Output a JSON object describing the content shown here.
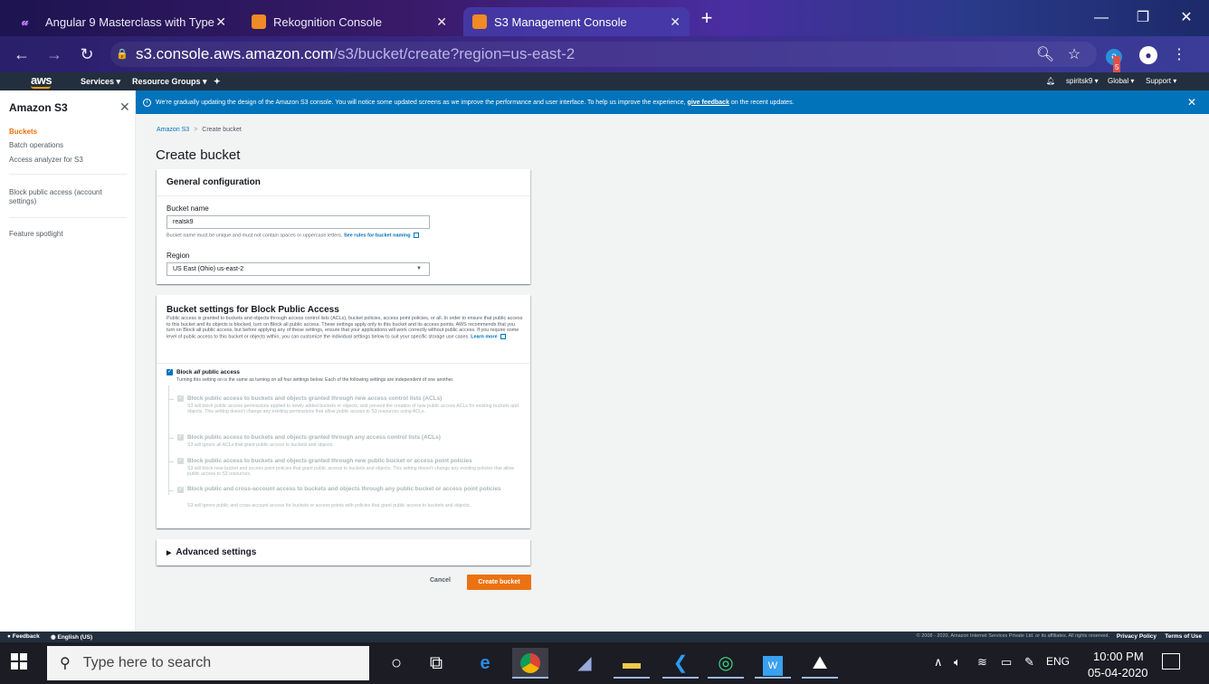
{
  "browser": {
    "tabs": [
      {
        "label": "Angular 9 Masterclass with Type",
        "icon": "udemy-icon",
        "color": "#a435f0",
        "active": false
      },
      {
        "label": "Rekognition Console",
        "icon": "aws-box-icon",
        "color": "#f90",
        "active": false
      },
      {
        "label": "S3 Management Console",
        "icon": "aws-box-icon",
        "color": "#f90",
        "active": true
      }
    ],
    "url_host": "s3.console.aws.amazon.com",
    "url_path": "/s3/bucket/create?region=us-east-2",
    "extension_badge": "5"
  },
  "aws_nav": {
    "logo": "aws",
    "services": "Services",
    "resource_groups": "Resource Groups",
    "user": "spiritsk9",
    "region": "Global",
    "support": "Support"
  },
  "sidebar": {
    "title": "Amazon S3",
    "items": [
      {
        "label": "Buckets",
        "active": true
      },
      {
        "label": "Batch operations"
      },
      {
        "label": "Access analyzer for S3"
      },
      {
        "label": "Block public access (account"
      },
      {
        "label": "settings)"
      },
      {
        "label": "Feature spotlight"
      }
    ]
  },
  "banner": {
    "text": "We're gradually updating the design of the Amazon S3 console. You will notice some updated screens as we improve the performance and user interface. To help us improve the experience,",
    "link": "give feedback",
    "tail": "on the recent updates."
  },
  "breadcrumb": {
    "root": "Amazon S3",
    "current": "Create bucket"
  },
  "page_title": "Create bucket",
  "general": {
    "header": "General configuration",
    "bucket_name_label": "Bucket name",
    "bucket_name_value": "realsk9",
    "bucket_name_hint": "Bucket name must be unique and must not contain spaces or uppercase letters.",
    "bucket_name_hint_link": "See rules for bucket naming",
    "region_label": "Region",
    "region_value": "US East (Ohio) us-east-2"
  },
  "bpa": {
    "title": "Bucket settings for Block Public Access",
    "description": "Public access is granted to buckets and objects through access control lists (ACLs), bucket policies, access point policies, or all. In order to ensure that public access to this bucket and its objects is blocked, turn on Block all public access. These settings apply only to this bucket and its access points. AWS recommends that you turn on Block all public access, but before applying any of these settings, ensure that your applications will work correctly without public access. If you require some level of public access to this bucket or objects within, you can customize the individual settings below to suit your specific storage use cases.",
    "learn_more": "Learn more",
    "block_all_title_pre": "Block ",
    "block_all_title_em": "all",
    "block_all_title_post": " public access",
    "block_all_desc": "Turning this setting on is the same as turning on all four settings below. Each of the following settings are independent of one another.",
    "options": [
      {
        "title": "Block public access to buckets and objects granted through new access control lists (ACLs)",
        "desc": "S3 will block public access permissions applied to newly added buckets or objects, and prevent the creation of new public access ACLs for existing buckets and objects. This setting doesn't change any existing permissions that allow public access to S3 resources using ACLs."
      },
      {
        "title": "Block public access to buckets and objects granted through any access control lists (ACLs)",
        "desc": "S3 will ignore all ACLs that grant public access to buckets and objects."
      },
      {
        "title": "Block public access to buckets and objects granted through new public bucket or access point policies",
        "desc": "S3 will block new bucket and access point policies that grant public access to buckets and objects. This setting doesn't change any existing policies that allow public access to S3 resources."
      },
      {
        "title": "Block public and cross-account access to buckets and objects through any public bucket or access point policies",
        "desc": "S3 will ignore public and cross-account access for buckets or access points with policies that grant public access to buckets and objects."
      }
    ]
  },
  "advanced": {
    "label": "Advanced settings"
  },
  "actions": {
    "cancel": "Cancel",
    "create": "Create bucket"
  },
  "footer": {
    "feedback": "Feedback",
    "language": "English (US)",
    "copyright": "© 2008 - 2020, Amazon Internet Services Private Ltd. or its affiliates. All rights reserved.",
    "privacy": "Privacy Policy",
    "terms": "Terms of Use"
  },
  "taskbar": {
    "search_placeholder": "Type here to search",
    "language": "ENG",
    "time": "10:00 PM",
    "date": "05-04-2020"
  },
  "colors": {
    "aws_orange": "#ec7211",
    "aws_blue": "#0073bb",
    "aws_navy": "#232f3e"
  }
}
